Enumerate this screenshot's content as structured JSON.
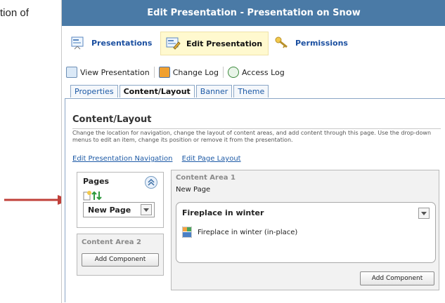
{
  "document": {
    "leading_text": "tion of"
  },
  "window": {
    "title": "Edit Presentation - Presentation on Snow"
  },
  "nav": {
    "items": [
      {
        "label": "Presentations",
        "icon": "presentations-icon"
      },
      {
        "label": "Edit Presentation",
        "icon": "edit-presentation-icon"
      },
      {
        "label": "Permissions",
        "icon": "key-icon"
      }
    ]
  },
  "toolbar": {
    "view_presentation": "View Presentation",
    "change_log": "Change Log",
    "access_log": "Access Log"
  },
  "tabs": [
    "Properties",
    "Content/Layout",
    "Banner",
    "Theme"
  ],
  "content": {
    "title": "Content/Layout",
    "description": "Change the location for navigation, change the layout of content areas, and add content through this page. Use the drop-down menus to edit an item, change its position or remove it from the presentation.",
    "link_nav": "Edit Presentation Navigation",
    "link_layout": "Edit Page Layout"
  },
  "pages_panel": {
    "title": "Pages",
    "selected_page": "New Page"
  },
  "content_area_2": {
    "title": "Content Area 2",
    "button": "Add Component"
  },
  "content_area_1": {
    "title": "Content Area 1",
    "page_name": "New Page",
    "component_title": "Fireplace in winter",
    "component_item": "Fireplace in winter (in-place)",
    "button": "Add Component"
  },
  "colors": {
    "title_bar": "#4a7aa6",
    "link": "#1d5aa6",
    "arrow": "#c0403a"
  }
}
